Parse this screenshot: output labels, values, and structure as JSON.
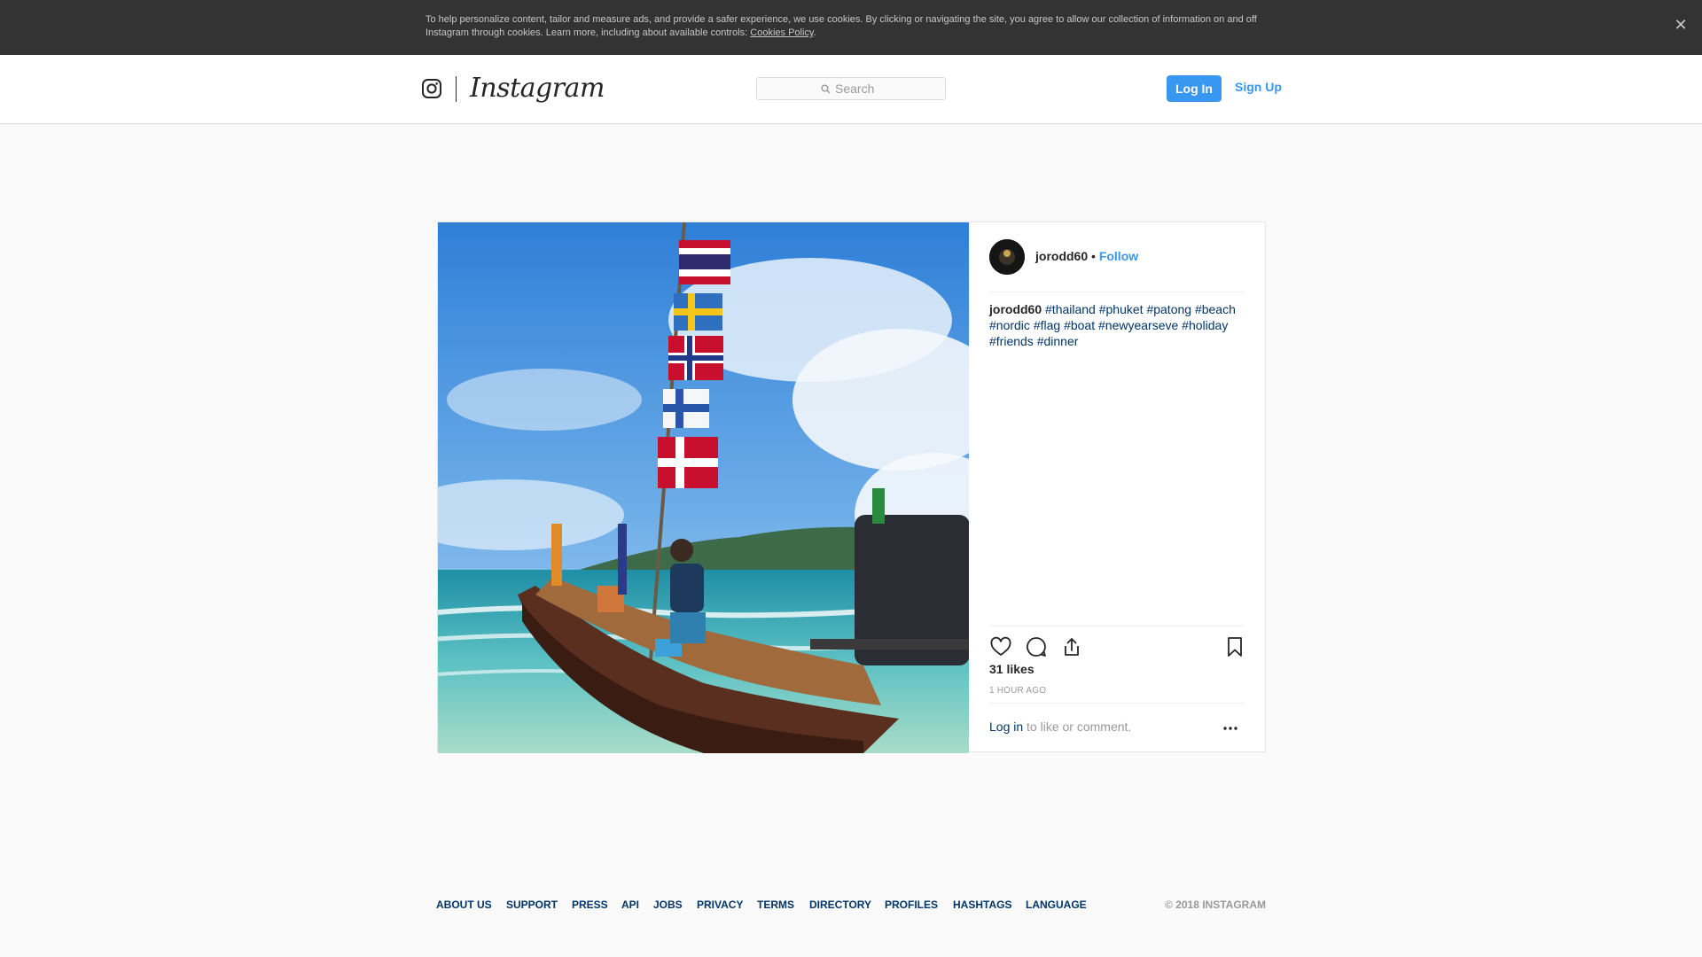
{
  "cookie_banner": {
    "text": "To help personalize content, tailor and measure ads, and provide a safer experience, we use cookies. By clicking or navigating the site, you agree to allow our collection of information on and off Instagram through cookies. Learn more, including about available controls: ",
    "link_label": "Cookies Policy",
    "trailing": ".",
    "close_icon": "close-icon"
  },
  "nav": {
    "logo_text": "Instagram",
    "logo_icon": "instagram-camera-icon",
    "search_placeholder": "Search",
    "search_icon": "search-icon",
    "login_label": "Log In",
    "signup_label": "Sign Up"
  },
  "post": {
    "author": "jorodd60",
    "separator": "•",
    "follow_label": "Follow",
    "caption_user": "jorodd60",
    "hashtags": [
      "#thailand",
      "#phuket",
      "#patong",
      "#beach",
      "#nordic",
      "#flag",
      "#boat",
      "#newyearseve",
      "#holiday",
      "#friends",
      "#dinner"
    ],
    "likes": "31 likes",
    "time": "1 HOUR AGO",
    "login_link": "Log in",
    "login_rest": " to like or comment.",
    "icons": [
      "heart-icon",
      "comment-icon",
      "share-icon",
      "bookmark-icon",
      "more-options-icon"
    ]
  },
  "footer": {
    "links": [
      "About us",
      "Support",
      "Press",
      "API",
      "Jobs",
      "Privacy",
      "Terms",
      "Directory",
      "Profiles",
      "Hashtags",
      "Language"
    ],
    "copyright": "© 2018 Instagram"
  },
  "colors": {
    "accent": "#3897f0",
    "link_dark": "#003569",
    "cookie_bg": "#333333",
    "page_bg": "#fafafa"
  }
}
